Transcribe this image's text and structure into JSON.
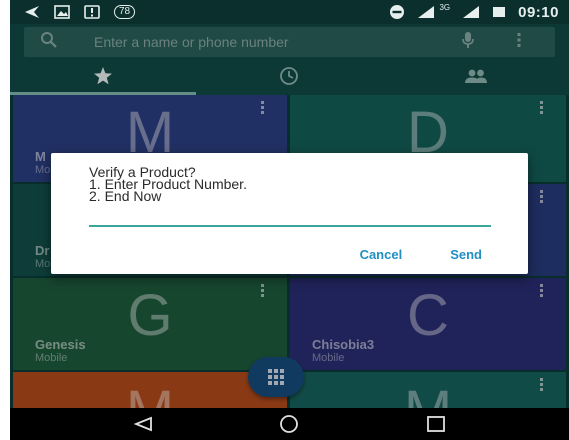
{
  "status_bar": {
    "notification_count": "78",
    "network_label": "3G",
    "time": "09:10",
    "icons": [
      "back-arrow-icon",
      "image-icon",
      "alert-icon",
      "do-not-disturb-icon",
      "signal-icon",
      "battery-icon"
    ]
  },
  "search": {
    "placeholder": "Enter a name or phone number",
    "value": "",
    "icons": [
      "search-icon",
      "mic-icon",
      "more-vert-icon"
    ]
  },
  "tabs": [
    {
      "icon": "star-icon",
      "active": true
    },
    {
      "icon": "clock-icon",
      "active": false
    },
    {
      "icon": "people-icon",
      "active": false
    }
  ],
  "tiles": [
    {
      "letter": "M",
      "name": "M",
      "sub": "Mo"
    },
    {
      "letter": "D",
      "name": "",
      "sub": ""
    },
    {
      "letter": "",
      "name": "Dr",
      "sub": "Mo"
    },
    {
      "letter": "",
      "name": "",
      "sub": ""
    },
    {
      "letter": "G",
      "name": "Genesis",
      "sub": "Mobile"
    },
    {
      "letter": "C",
      "name": "Chisobia3",
      "sub": "Mobile"
    },
    {
      "letter": "M",
      "name": "",
      "sub": ""
    },
    {
      "letter": "M",
      "name": "",
      "sub": ""
    }
  ],
  "dialog": {
    "lines": [
      "Verify a Product?",
      "1. Enter Product Number.",
      "2. End Now"
    ],
    "input_value": "",
    "cancel_label": "Cancel",
    "send_label": "Send"
  },
  "navbar": {
    "icons": [
      "back-triangle-icon",
      "home-circle-icon",
      "recents-square-icon"
    ]
  },
  "colors": {
    "accent": "#3aa79c",
    "dialog_button": "#1f8fc4",
    "tile_blue": "#2b3e80",
    "tile_teal": "#145e58",
    "tile_green": "#1e5a3c",
    "tile_indigo": "#2a2e73",
    "tile_orange": "#b14a1b"
  }
}
